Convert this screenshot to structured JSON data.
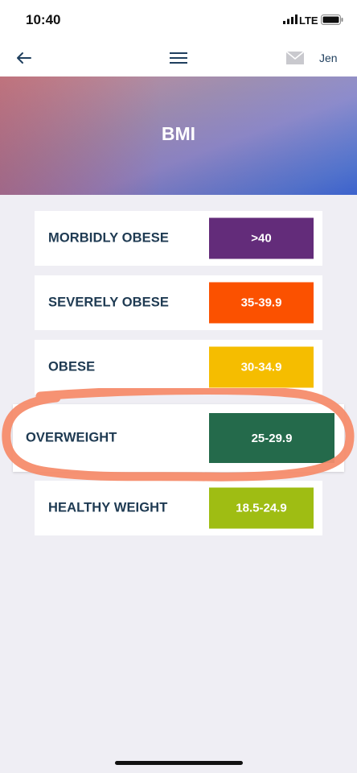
{
  "status": {
    "time": "10:40",
    "network": "LTE"
  },
  "nav": {
    "user": "Jen"
  },
  "header": {
    "title": "BMI"
  },
  "bmi_categories": [
    {
      "label": "MORBIDLY OBESE",
      "range": ">40",
      "color": "#632c7a"
    },
    {
      "label": "SEVERELY OBESE",
      "range": "35-39.9",
      "color": "#fb5100"
    },
    {
      "label": "OBESE",
      "range": "30-34.9",
      "color": "#f5bd00"
    },
    {
      "label": "OVERWEIGHT",
      "range": "25-29.9",
      "color": "#246a4b",
      "highlighted": true
    },
    {
      "label": "HEALTHY WEIGHT",
      "range": "18.5-24.9",
      "color": "#9fbd13"
    }
  ],
  "annotation": {
    "color": "#f58c6c"
  },
  "icons": {
    "back": "arrow-left-icon",
    "menu": "hamburger-menu-icon",
    "mail": "envelope-icon",
    "signal": "cellular-signal-icon",
    "battery": "battery-icon"
  }
}
